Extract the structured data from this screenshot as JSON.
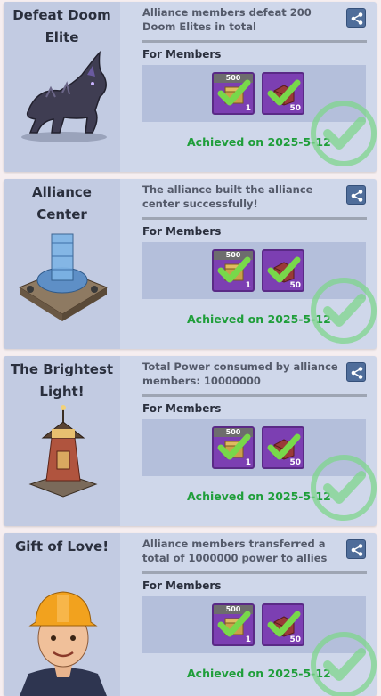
{
  "cards": [
    {
      "title": "Defeat Doom Elite",
      "description": "Alliance members defeat 200 Doom Elites in total",
      "members_label": "For Members",
      "rewards": [
        {
          "tag": "500",
          "qty": "1",
          "icon": "boost-chest-icon"
        },
        {
          "tag": "",
          "qty": "50",
          "icon": "supply-box-icon"
        }
      ],
      "achieved": "Achieved on 2025-5-12",
      "illustration": "doom-wolf-icon"
    },
    {
      "title": "Alliance Center",
      "description": "The alliance built the alliance center successfully!",
      "members_label": "For Members",
      "rewards": [
        {
          "tag": "500",
          "qty": "1",
          "icon": "boost-chest-icon"
        },
        {
          "tag": "",
          "qty": "50",
          "icon": "supply-box-icon"
        }
      ],
      "achieved": "Achieved on 2025-5-12",
      "illustration": "alliance-center-building-icon"
    },
    {
      "title": "The Brightest Light!",
      "description": "Total Power consumed by alliance members: 10000000",
      "members_label": "For Members",
      "rewards": [
        {
          "tag": "500",
          "qty": "1",
          "icon": "boost-chest-icon"
        },
        {
          "tag": "",
          "qty": "50",
          "icon": "supply-box-icon"
        }
      ],
      "achieved": "Achieved on 2025-5-12",
      "illustration": "lighthouse-tower-icon"
    },
    {
      "title": "Gift of Love!",
      "description": "Alliance members transferred a total of 1000000 power to allies",
      "members_label": "For Members",
      "rewards": [
        {
          "tag": "500",
          "qty": "1",
          "icon": "boost-chest-icon"
        },
        {
          "tag": "",
          "qty": "50",
          "icon": "supply-box-icon"
        }
      ],
      "achieved": "Achieved on 2025-5-12",
      "illustration": "engineer-worker-icon"
    }
  ],
  "colors": {
    "card_bg": "#cfd7ea",
    "achieved_green": "#1f9e3a",
    "reward_purple": "#7c3fb2"
  }
}
